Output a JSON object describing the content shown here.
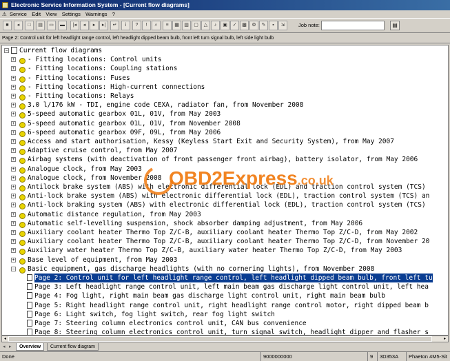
{
  "window": {
    "title": "Electronic Service Information System - [Current flow diagrams]"
  },
  "menu": {
    "items": [
      "Service",
      "Edit",
      "View",
      "Settings",
      "Warnings",
      "?"
    ]
  },
  "toolbar": {
    "job_note_label": "Job note:",
    "job_note_value": ""
  },
  "infobar": {
    "text": "Page 2: Control unit for left headlight range control, left headlight dipped beam bulb, front left turn signal bulb, left side light bulb"
  },
  "tree": {
    "root": "Current flow diagrams",
    "items": [
      "- Fitting locations: Control units",
      "- Fitting locations: Coupling stations",
      "- Fitting locations: Fuses",
      "- Fitting locations: High-current connections",
      "- Fitting locations: Relays",
      "3.0 l/176 kW - TDI, engine code CEXA, radiator fan, from November 2008",
      "5-speed automatic gearbox 01L, 01V, from May 2003",
      "5-speed automatic gearbox 01L, 01V, from November 2008",
      "6-speed automatic gearbox 09F, 09L, from May 2006",
      "Access and start authorisation, Kessy (Keyless Start Exit and Security System), from May 2007",
      "Adaptive cruise control, from May 2007",
      "Airbag systems (with deactivation of front passenger front airbag), battery isolator, from May 2006",
      "Analogue clock, from May 2003",
      "Analogue clock, from November 2008",
      "Antilock brake system (ABS) with electronic differential lock (EDL) and traction control system (TCS)",
      "Anti-lock brake system (ABS) with electronic differential lock (EDL), traction control system (TCS) an",
      "Anti-lock braking system (ABS) with electronic differential lock (EDL), traction control system (TCS)",
      "Automatic distance regulation, from May 2003",
      "Automatic self-levelling suspension, shock absorber damping adjustment, from May 2006",
      "Auxiliary coolant heater Thermo Top Z/C-B, auxiliary coolant heater Thermo Top Z/C-D, from May 2002",
      "Auxiliary coolant heater Thermo Top Z/C-B, auxiliary coolant heater Thermo Top Z/C-D, from November 20",
      "Auxiliary water heater Thermo Top Z/C-B, auxiliary water heater Thermo Top Z/C-D, from May 2003",
      "Base level of equipment, from May 2003",
      "Basic equipment, gas discharge headlights (with no cornering lights), from November 2008"
    ],
    "pages": [
      "Page 2: Control unit for left headlight range control, left headlight dipped beam bulb, front left tu",
      "Page 3: Left headlight range control unit, left main beam gas discharge light control unit, left hea",
      "Page 4: Fog light, right main beam gas discharge light control unit, right main beam bulb",
      "Page 5: Right headlight range control unit, right headlight range control motor, right dipped beam b",
      "Page 6: Light switch, fog light switch, rear fog light switch",
      "Page 7: Steering column electronics control unit, CAN bus convenience",
      "Page 8: Steering column electronics control unit, turn signal switch, headlight dipper and flasher s"
    ]
  },
  "tabs": [
    "Overview",
    "Current flow diagram"
  ],
  "status": {
    "left": "Done",
    "mid": "9000000000",
    "num": "9",
    "code": "3D353A",
    "model": "Phaeton 4M5-Sit"
  },
  "watermark": {
    "text": "OBD2Express",
    "suffix": ".co.uk"
  },
  "colors": {
    "selection": "#0a3d91",
    "folder": "#e8d400",
    "title_start": "#0a246a",
    "watermark": "#f07a10"
  }
}
